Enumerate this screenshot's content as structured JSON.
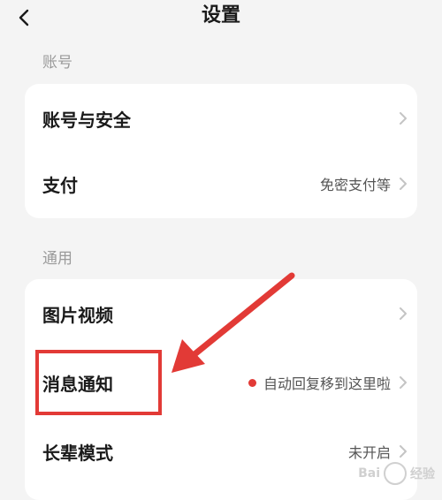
{
  "header": {
    "title": "设置",
    "back_icon": "chevron-left-icon"
  },
  "sections": [
    {
      "label": "账号",
      "rows": [
        {
          "label": "账号与安全",
          "value": ""
        },
        {
          "label": "支付",
          "value": "免密支付等"
        }
      ]
    },
    {
      "label": "通用",
      "rows": [
        {
          "label": "图片视频",
          "value": ""
        },
        {
          "label": "消息通知",
          "value": "自动回复移到这里啦"
        },
        {
          "label": "长辈模式",
          "value": "未开启"
        }
      ]
    }
  ],
  "colors": {
    "accent": "#e23a36",
    "background": "#f4f4f4",
    "card": "#ffffff",
    "muted": "#9a9a9a"
  },
  "watermark": {
    "text": "Bai",
    "text2": "经验"
  }
}
